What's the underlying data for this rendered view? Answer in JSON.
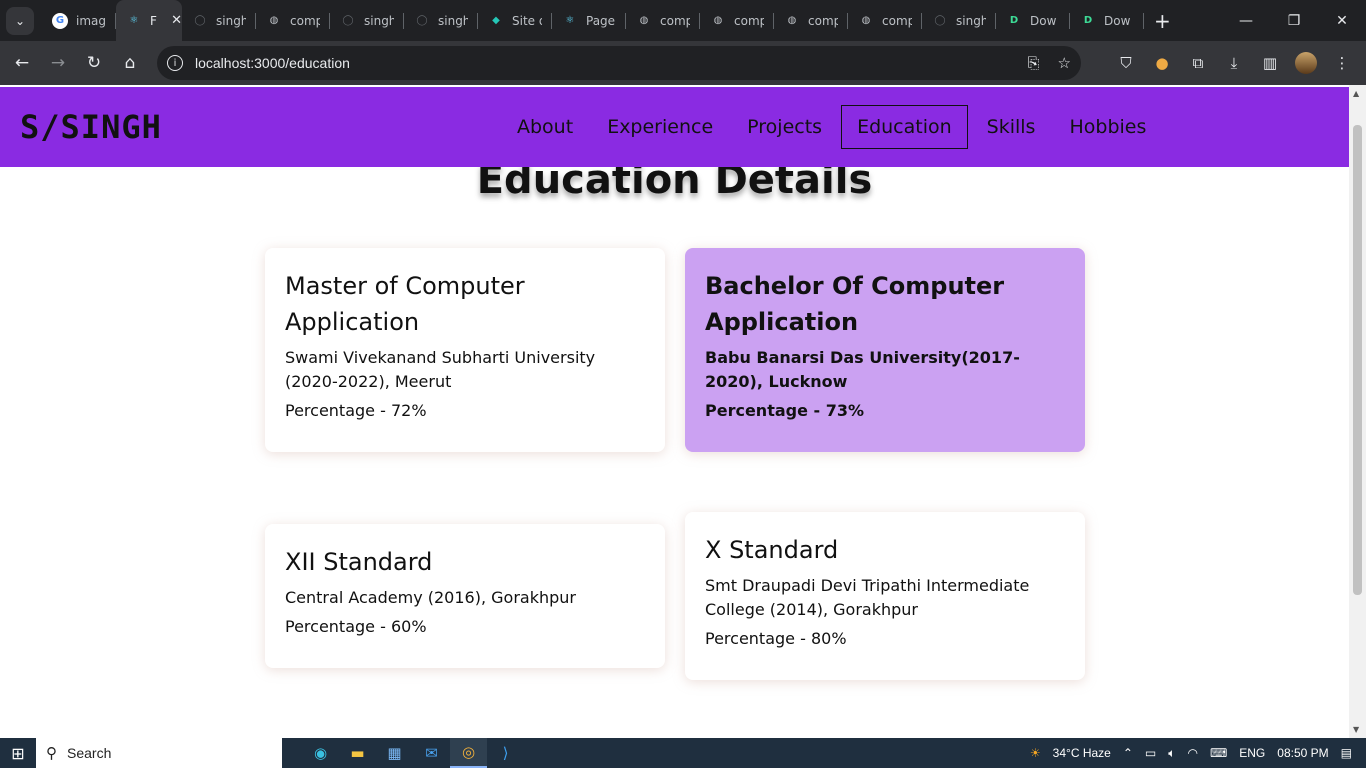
{
  "browser": {
    "tabs": [
      {
        "title": "imag",
        "icon": "google-icon"
      },
      {
        "title": "F",
        "icon": "react-icon",
        "active": true
      },
      {
        "title": "singh",
        "icon": "github-icon"
      },
      {
        "title": "comp",
        "icon": "globe-icon"
      },
      {
        "title": "singh",
        "icon": "github-icon"
      },
      {
        "title": "singh",
        "icon": "github-icon"
      },
      {
        "title": "Site d",
        "icon": "netlify-icon"
      },
      {
        "title": "Page",
        "icon": "react-icon"
      },
      {
        "title": "comp",
        "icon": "globe-icon"
      },
      {
        "title": "comp",
        "icon": "globe-icon"
      },
      {
        "title": "comp",
        "icon": "globe-icon"
      },
      {
        "title": "comp",
        "icon": "globe-icon"
      },
      {
        "title": "singh",
        "icon": "github-icon"
      },
      {
        "title": "Dow",
        "icon": "d-icon"
      },
      {
        "title": "Dow",
        "icon": "d-icon"
      }
    ],
    "url": "localhost:3000/education"
  },
  "site": {
    "brand": "S/SINGH",
    "nav": [
      "About",
      "Experience",
      "Projects",
      "Education",
      "Skills",
      "Hobbies"
    ],
    "active_nav": "Education",
    "accent_color": "#8a2be2"
  },
  "page": {
    "title": "Education Details",
    "cards": [
      {
        "degree": "Master of Computer Application",
        "institution": "Swami Vivekanand Subharti University (2020-2022), Meerut",
        "percentage": "Percentage - 72%"
      },
      {
        "degree": "Bachelor Of Computer Application",
        "institution": "Babu Banarsi Das University(2017-2020), Lucknow",
        "percentage": "Percentage - 73%"
      },
      {
        "degree": "XII Standard",
        "institution": "Central Academy (2016), Gorakhpur",
        "percentage": "Percentage - 60%"
      },
      {
        "degree": "X Standard",
        "institution": "Smt Draupadi Devi Tripathi Intermediate College (2014), Gorakhpur",
        "percentage": "Percentage - 80%"
      }
    ],
    "highlight_color": "#cba1f2"
  },
  "taskbar": {
    "search_label": "Search",
    "weather": "34°C  Haze",
    "language": "ENG",
    "time": "08:50 PM"
  }
}
